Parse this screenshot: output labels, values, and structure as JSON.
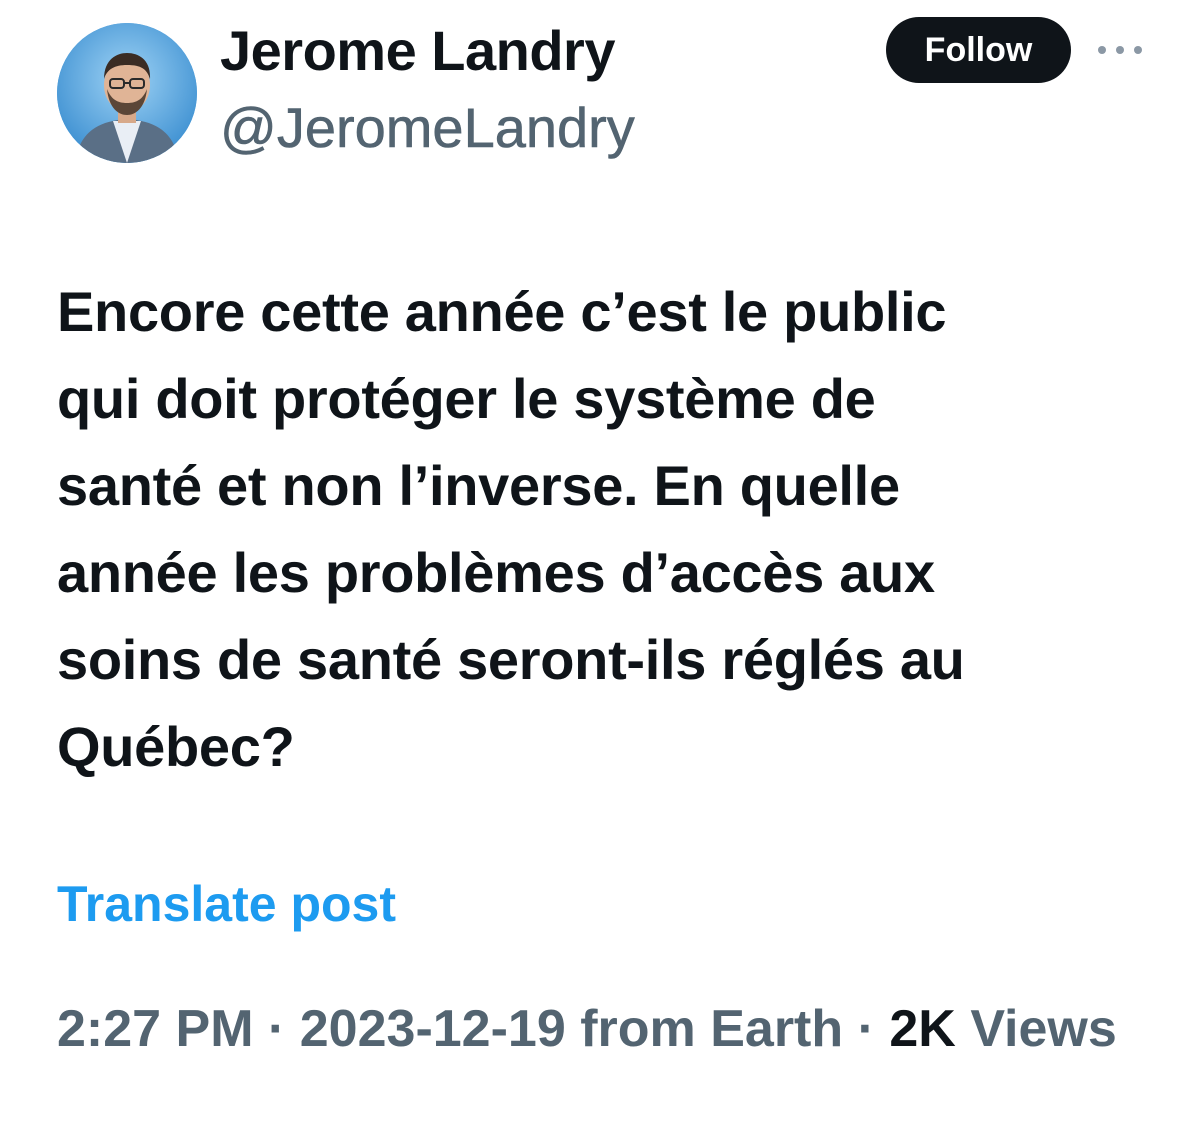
{
  "author": {
    "display_name": "Jerome Landry",
    "handle": "@JeromeLandry"
  },
  "actions": {
    "follow_label": "Follow"
  },
  "tweet": {
    "text_lines": [
      "Encore cette année c’est le public",
      "qui doit protéger le système de",
      "santé et non l’inverse. En quelle",
      "année les problèmes d’accès aux",
      "soins de santé seront-ils réglés au",
      "Québec?"
    ]
  },
  "translate_label": "Translate post",
  "meta": {
    "time": "2:27 PM",
    "separator": "·",
    "date": "2023-12-19",
    "location": "from Earth",
    "views_count": "2K",
    "views_label": "Views"
  },
  "icons": {
    "more": "more-horizontal-icon"
  },
  "colors": {
    "text_primary": "#0f1419",
    "text_secondary": "#536471",
    "link": "#1d9bf0",
    "button_bg": "#0f1419",
    "avatar_bg": "#4fa3e0"
  }
}
